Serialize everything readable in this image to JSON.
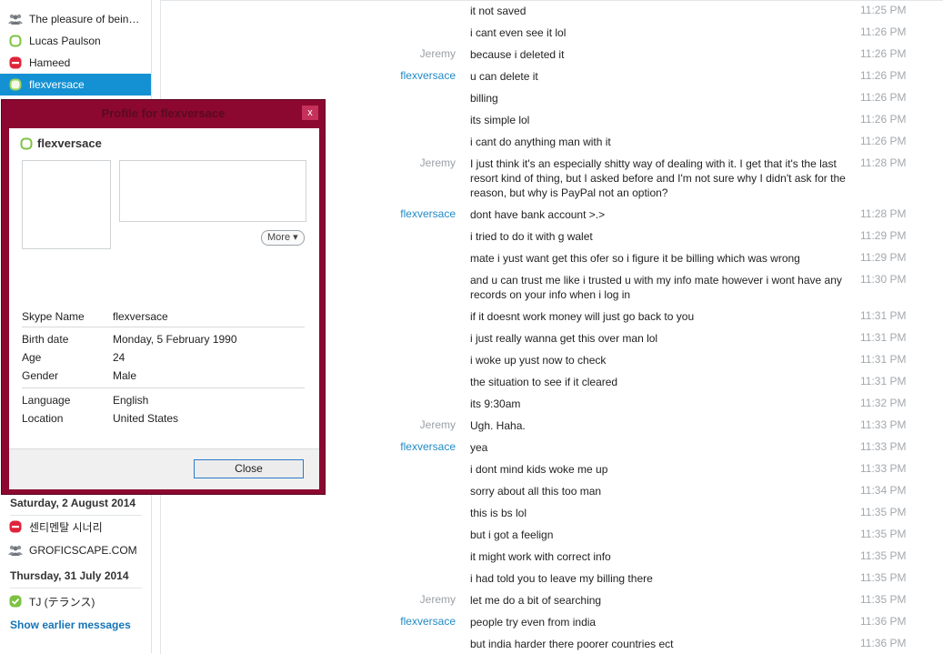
{
  "sidebar": {
    "contacts": [
      {
        "label": "The pleasure of being cu...",
        "icon": "group-icon"
      },
      {
        "label": "Lucas Paulson",
        "icon": "status-offline-icon"
      },
      {
        "label": "Hameed",
        "icon": "status-busy-icon"
      },
      {
        "label": "flexversace",
        "icon": "status-offline-icon",
        "selected": true
      }
    ],
    "sections": [
      {
        "date": "Saturday, 2 August 2014",
        "items": [
          {
            "label": "센티멘탈 시너리",
            "icon": "status-busy-icon"
          },
          {
            "label": "GROFICSCAPE.COM",
            "icon": "group-icon"
          }
        ]
      },
      {
        "date": "Thursday, 31 July 2014",
        "items": [
          {
            "label": "TJ (テランス)",
            "icon": "status-online-icon"
          }
        ]
      }
    ],
    "show_earlier": "Show earlier messages"
  },
  "profile": {
    "title": "Profile for flexversace",
    "name": "flexversace",
    "more": "More",
    "fields": {
      "skype_name": {
        "k": "Skype Name",
        "v": "flexversace"
      },
      "birth_date": {
        "k": "Birth date",
        "v": "Monday, 5 February 1990"
      },
      "age": {
        "k": "Age",
        "v": "24"
      },
      "gender": {
        "k": "Gender",
        "v": "Male"
      },
      "language": {
        "k": "Language",
        "v": "English"
      },
      "location": {
        "k": "Location",
        "v": "United States"
      }
    },
    "close_label": "Close",
    "close_x": "x"
  },
  "messages": [
    {
      "who": "",
      "text": "it not saved",
      "time": "11:25 PM"
    },
    {
      "who": "",
      "text": "i cant even see it lol",
      "time": "11:26 PM"
    },
    {
      "who": "Jeremy",
      "text": "because i deleted it",
      "time": "11:26 PM"
    },
    {
      "who": "flexversace",
      "text": "u can delete it",
      "time": "11:26 PM"
    },
    {
      "who": "",
      "text": "billing",
      "time": "11:26 PM"
    },
    {
      "who": "",
      "text": "its simple lol",
      "time": "11:26 PM"
    },
    {
      "who": "",
      "text": "i cant do anything man with it",
      "time": "11:26 PM"
    },
    {
      "who": "Jeremy",
      "text": "I just think it's an especially shitty way of dealing with it. I get that it's the last resort kind of thing, but I asked before and I'm not sure why I didn't ask for the reason, but why is PayPal not an option?",
      "time": "11:28 PM"
    },
    {
      "who": "flexversace",
      "text": "dont have bank account >.>",
      "time": "11:28 PM"
    },
    {
      "who": "",
      "text": "i tried to do it with g walet",
      "time": "11:29 PM"
    },
    {
      "who": "",
      "text": "mate i yust want get this ofer so i figure it be billing which was wrong",
      "time": "11:29 PM"
    },
    {
      "who": "",
      "text": "and u can trust me like i trusted u with my info mate however i wont  have any records on your info when i log in",
      "time": "11:30 PM"
    },
    {
      "who": "",
      "text": "if it doesnt work money will just go back to you",
      "time": "11:31 PM"
    },
    {
      "who": "",
      "text": "i just really wanna get this over man lol",
      "time": "11:31 PM"
    },
    {
      "who": "",
      "text": "i woke up yust now to check",
      "time": "11:31 PM"
    },
    {
      "who": "",
      "text": "the situation to see if it cleared",
      "time": "11:31 PM"
    },
    {
      "who": "",
      "text": "its 9:30am",
      "time": "11:32 PM"
    },
    {
      "who": "Jeremy",
      "text": "Ugh. Haha.",
      "time": "11:33 PM"
    },
    {
      "who": "flexversace",
      "text": "yea",
      "time": "11:33 PM"
    },
    {
      "who": "",
      "text": "i dont mind kids woke me up",
      "time": "11:33 PM"
    },
    {
      "who": "",
      "text": "sorry about all this too man",
      "time": "11:34 PM"
    },
    {
      "who": "",
      "text": "this is bs lol",
      "time": "11:35 PM"
    },
    {
      "who": "",
      "text": "but i got a feelign",
      "time": "11:35 PM"
    },
    {
      "who": "",
      "text": "it might work with correct info",
      "time": "11:35 PM"
    },
    {
      "who": "",
      "text": "i had told you to leave my billing there",
      "time": "11:35 PM"
    },
    {
      "who": "Jeremy",
      "text": "let me do a bit of searching",
      "time": "11:35 PM"
    },
    {
      "who": "flexversace",
      "text": "people try even from india",
      "time": "11:36 PM"
    },
    {
      "who": "",
      "text": "but india harder there poorer countries ect",
      "time": "11:36 PM"
    }
  ],
  "colors": {
    "accent": "#1391d3",
    "profile_frame": "#8c0830",
    "sender_self": "#1f8ac6",
    "sender_other": "#9aa0a6",
    "status_offline": "#7cc242",
    "status_busy": "#e0233b",
    "status_online": "#7cc242"
  }
}
